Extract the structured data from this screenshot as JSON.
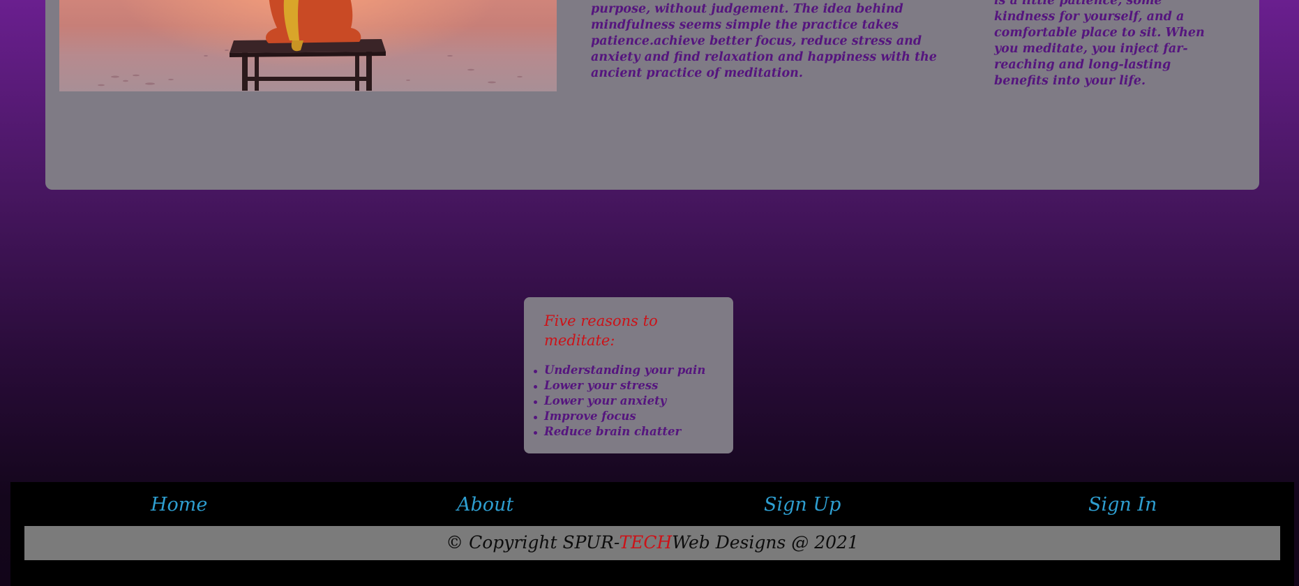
{
  "content": {
    "intro_paragraph": "purpose, without judgement. The idea behind mindfulness seems simple the practice takes patience.achieve better focus, reduce stress and anxiety and find relaxation and happiness with the ancient practice of meditation.",
    "side_paragraph": "is a little patience, some kindness for yourself, and a comfortable place to sit. When you meditate, you inject far-reaching and long-lasting benefits into your life."
  },
  "reasons": {
    "title": "Five reasons to meditate:",
    "items": [
      "Understanding your pain",
      "Lower your stress",
      "Lower your anxiety",
      "Improve focus",
      "Reduce brain chatter"
    ]
  },
  "footer": {
    "nav": {
      "home": "Home",
      "about": "About",
      "sign_up": "Sign Up",
      "sign_in": "Sign In"
    },
    "copyright": {
      "prefix": "© Copyright SPUR-",
      "brand": "TECH",
      "suffix": "Web Designs @ 2021"
    }
  },
  "colors": {
    "accent_red": "#cc1218",
    "text_purple": "#55157e",
    "link_blue": "#2e9ed0",
    "card_gray": "#7f7b85"
  }
}
